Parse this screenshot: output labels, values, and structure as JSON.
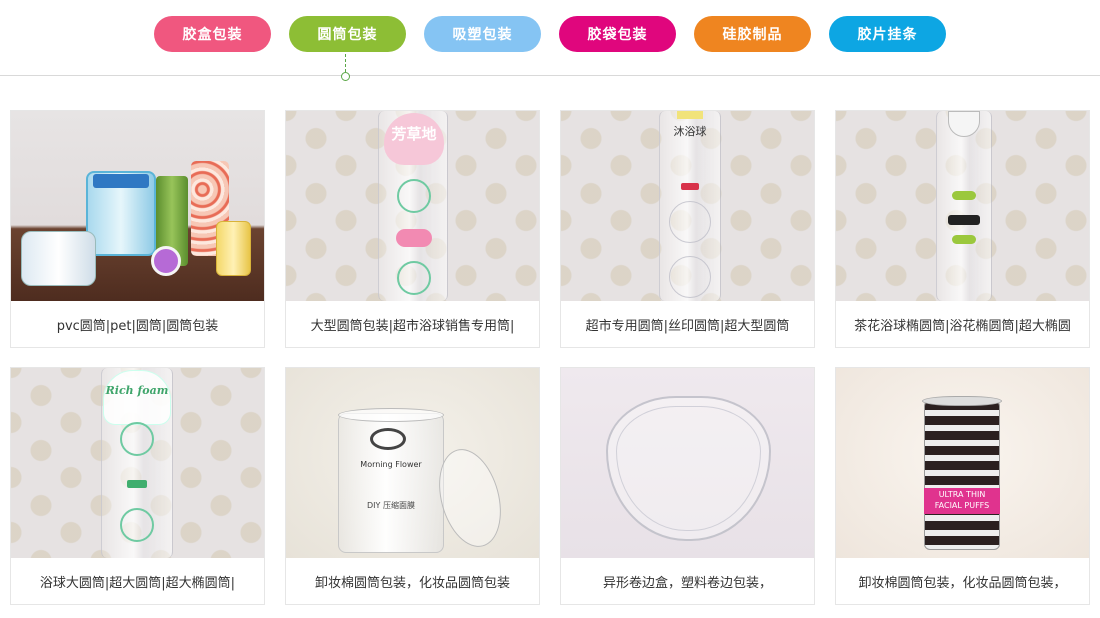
{
  "tabs": [
    {
      "label": "胶盒包装",
      "color": "#f0577f",
      "active": false
    },
    {
      "label": "圆筒包装",
      "color": "#8dbe35",
      "active": true
    },
    {
      "label": "吸塑包装",
      "color": "#85c4f3",
      "active": false
    },
    {
      "label": "胶袋包装",
      "color": "#e0067d",
      "active": false
    },
    {
      "label": "硅胶制品",
      "color": "#ef8520",
      "active": false
    },
    {
      "label": "胶片挂条",
      "color": "#0da6e3",
      "active": false
    }
  ],
  "active_indicator_color": "#5aa646",
  "products": [
    {
      "caption": "pvc圆筒|pet|圆筒|圆筒包装",
      "image": "assorted-cylinder-boxes-photo"
    },
    {
      "caption": "大型圆筒包装|超市浴球销售专用筒|",
      "image": "large-tube-bath-ball-photo",
      "print_text": "芳草地"
    },
    {
      "caption": "超市专用圆筒|丝印圆筒|超大型圆筒",
      "image": "supermarket-tube-photo",
      "print_text": "沐浴球"
    },
    {
      "caption": "茶花浴球椭圆筒|浴花椭圆筒|超大椭圆",
      "image": "oval-tube-photo"
    },
    {
      "caption": "浴球大圆筒|超大圆筒|超大椭圆筒|",
      "image": "bath-ball-big-tube-photo",
      "print_text": "Rich foam"
    },
    {
      "caption": "卸妆棉圆筒包装，化妆品圆筒包装",
      "image": "makeup-cotton-tube-photo",
      "print_text": "Morning Flower",
      "print_text_2": "DIY 压缩面膜"
    },
    {
      "caption": "异形卷边盒，塑料卷边包装，",
      "image": "shaped-curled-edge-box-photo"
    },
    {
      "caption": "卸妆棉圆筒包装，化妆品圆筒包装，",
      "image": "facial-puffs-tube-photo",
      "print_text": "ULTRA THIN",
      "print_text_2": "FACIAL PUFFS"
    }
  ]
}
